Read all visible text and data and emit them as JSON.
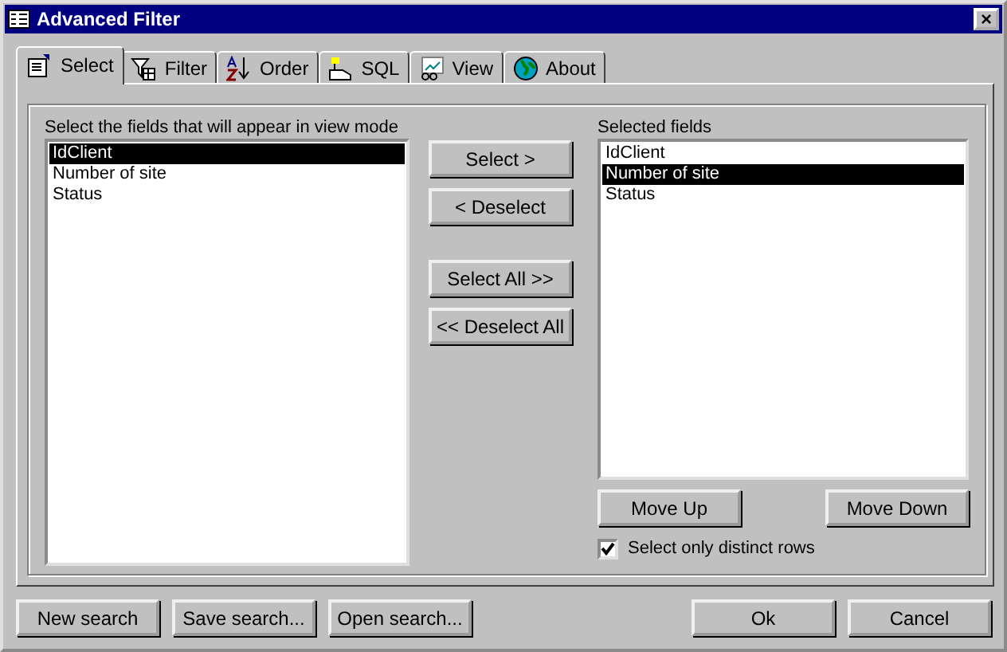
{
  "window": {
    "title": "Advanced Filter",
    "close": "×"
  },
  "tabs": [
    {
      "label": "Select",
      "selected": true
    },
    {
      "label": "Filter",
      "selected": false
    },
    {
      "label": "Order",
      "selected": false
    },
    {
      "label": "SQL",
      "selected": false
    },
    {
      "label": "View",
      "selected": false
    },
    {
      "label": "About",
      "selected": false
    }
  ],
  "available": {
    "label": "Select the fields that will appear in view mode",
    "items": [
      {
        "label": "IdClient",
        "selected": true
      },
      {
        "label": "Number of site",
        "selected": false
      },
      {
        "label": "Status",
        "selected": false
      }
    ]
  },
  "move_buttons": [
    {
      "label": "Select >"
    },
    {
      "label": "< Deselect"
    },
    {
      "label": "Select All >>"
    },
    {
      "label": "<< Deselect All"
    }
  ],
  "selected_fields": {
    "label": "Selected fields",
    "items": [
      {
        "label": "IdClient",
        "selected": false
      },
      {
        "label": "Number of site",
        "selected": true
      },
      {
        "label": "Status",
        "selected": false
      }
    ]
  },
  "order_buttons": [
    {
      "label": "Move Up"
    },
    {
      "label": "Move Down"
    }
  ],
  "distinct": {
    "label": "Select only distinct rows",
    "checked": true
  },
  "footer_left": [
    {
      "label": "New search"
    },
    {
      "label": "Save search..."
    },
    {
      "label": "Open search..."
    }
  ],
  "footer_right": [
    {
      "label": "Ok"
    },
    {
      "label": "Cancel"
    }
  ]
}
